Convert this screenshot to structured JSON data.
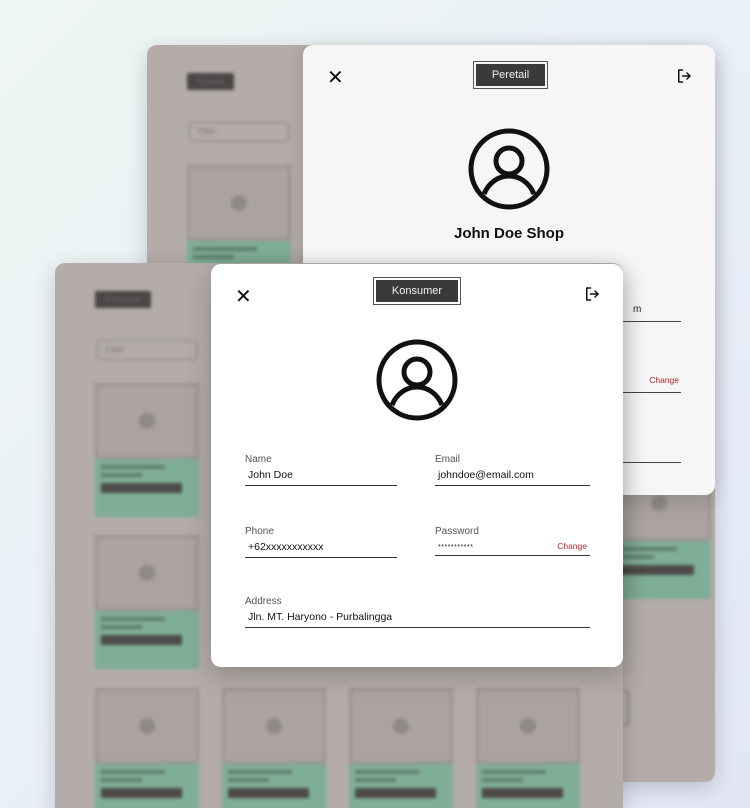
{
  "back_app": {
    "header_chip": "Peretail",
    "filter": "Filter"
  },
  "front_app": {
    "header_chip": "Konsumer",
    "filter": "Filter"
  },
  "retailer_panel": {
    "role_label": "Peretail",
    "shop_name": "John Doe Shop",
    "partial_email_tail": "m",
    "change_label": "Change"
  },
  "consumer_panel": {
    "role_label": "Konsumer",
    "fields": {
      "name": {
        "label": "Name",
        "value": "John Doe"
      },
      "email": {
        "label": "Email",
        "value": "johndoe@email.com"
      },
      "phone": {
        "label": "Phone",
        "value": "+62xxxxxxxxxxx"
      },
      "password": {
        "label": "Password",
        "value": "***********",
        "action": "Change"
      },
      "address": {
        "label": "Address",
        "value": "Jln. MT. Haryono - Purbalingga"
      }
    }
  },
  "icons": {
    "close": "close-icon",
    "logout": "logout-icon",
    "avatar": "user-avatar-icon"
  }
}
